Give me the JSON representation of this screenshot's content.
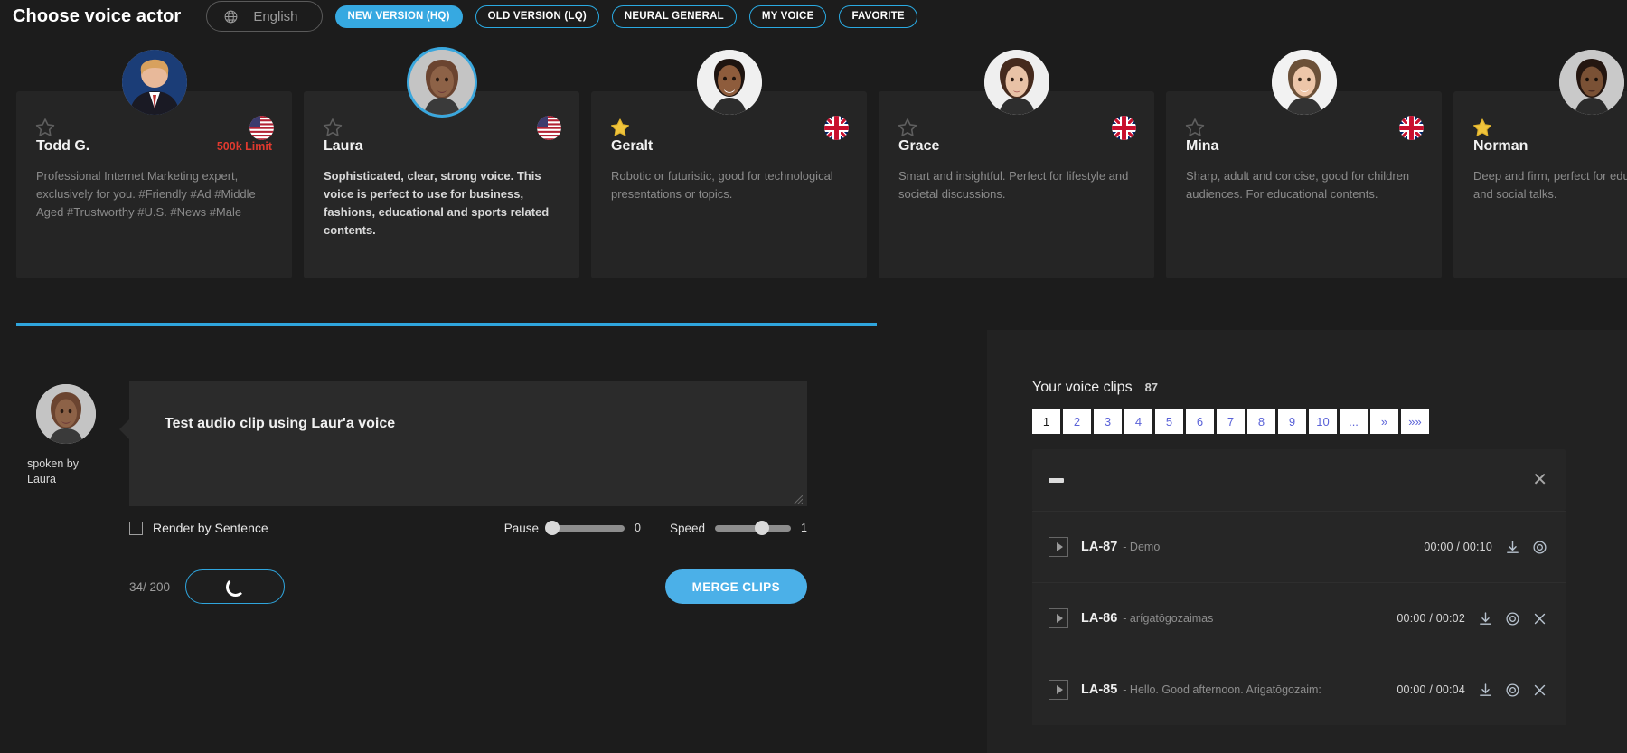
{
  "header": {
    "title": "Choose voice actor",
    "language": "English",
    "tabs": [
      {
        "label": "NEW VERSION (HQ)",
        "active": true
      },
      {
        "label": "OLD VERSION (LQ)",
        "active": false
      },
      {
        "label": "NEURAL GENERAL",
        "active": false
      },
      {
        "label": "MY VOICE",
        "active": false
      },
      {
        "label": "FAVORITE",
        "active": false
      }
    ]
  },
  "voice_cards": [
    {
      "name": "Todd G.",
      "limit": "500k Limit",
      "description": "Professional Internet Marketing expert, exclusively for you. #Friendly #Ad #Middle Aged #Trustworthy #U.S. #News #Male",
      "flag": "us-flag-icon",
      "favorite": false,
      "selected": false
    },
    {
      "name": "Laura",
      "limit": "",
      "description": "Sophisticated, clear, strong voice. This voice is perfect to use for business, fashions, educational and sports related contents.",
      "flag": "us-flag-icon",
      "favorite": false,
      "selected": true
    },
    {
      "name": "Geralt",
      "limit": "",
      "description": "Robotic or futuristic, good for technological presentations or topics.",
      "flag": "uk-flag-icon",
      "favorite": true,
      "selected": false
    },
    {
      "name": "Grace",
      "limit": "",
      "description": "Smart and insightful. Perfect for lifestyle and societal discussions.",
      "flag": "uk-flag-icon",
      "favorite": false,
      "selected": false
    },
    {
      "name": "Mina",
      "limit": "",
      "description": "Sharp, adult and concise, good for children audiences. For educational contents.",
      "flag": "uk-flag-icon",
      "favorite": false,
      "selected": false
    },
    {
      "name": "Norman",
      "limit": "",
      "description": "Deep and firm, perfect for educational topics and social talks.",
      "flag": "",
      "favorite": true,
      "selected": false
    }
  ],
  "editor": {
    "spoken_by": "spoken by\nLaura",
    "text_value": "Test audio clip using Laur'a voice",
    "render_by_sentence_label": "Render by Sentence",
    "render_by_sentence_checked": false,
    "pause_label": "Pause",
    "pause_value": "0",
    "speed_label": "Speed",
    "speed_value": "1",
    "char_count": "34/ 200",
    "merge_clips_label": "MERGE CLIPS",
    "render_button_state": "loading"
  },
  "clips_panel": {
    "title": "Your voice clips",
    "count": "87",
    "pages": [
      {
        "label": "1",
        "active": true
      },
      {
        "label": "2",
        "active": false
      },
      {
        "label": "3",
        "active": false
      },
      {
        "label": "4",
        "active": false
      },
      {
        "label": "5",
        "active": false
      },
      {
        "label": "6",
        "active": false
      },
      {
        "label": "7",
        "active": false
      },
      {
        "label": "8",
        "active": false
      },
      {
        "label": "9",
        "active": false
      },
      {
        "label": "10",
        "active": false
      },
      {
        "label": "...",
        "active": false
      },
      {
        "label": "»",
        "active": false
      },
      {
        "label": "»»",
        "active": false
      }
    ],
    "clips": [
      {
        "id": "LA-87",
        "text": "- Demo",
        "time": "00:00 / 00:10",
        "has_delete": false
      },
      {
        "id": "LA-86",
        "text": "- arígatōgozaimas",
        "time": "00:00 / 00:02",
        "has_delete": true
      },
      {
        "id": "LA-85",
        "text": "- Hello. Good afternoon. Arigatōgozaim:",
        "time": "00:00 / 00:04",
        "has_delete": true
      }
    ]
  },
  "colors": {
    "accent": "#36a9e1",
    "limit_red": "#e03a2f",
    "page_link": "#5a62d8"
  }
}
